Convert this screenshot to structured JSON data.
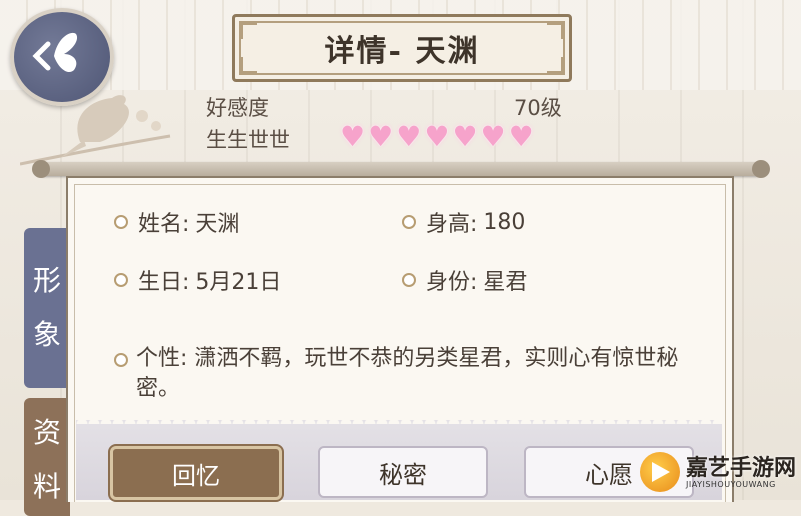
{
  "header": {
    "title": "详情- 天渊"
  },
  "affection": {
    "label": "好感度",
    "level": "70级",
    "tier": "生生世世",
    "hearts": [
      "♥",
      "♥",
      "♥",
      "♥",
      "♥",
      "♥",
      "♥"
    ],
    "heart_color": "#f6a3cb"
  },
  "side_tabs": [
    {
      "label_top": "形",
      "label_bottom": "象"
    },
    {
      "label_top": "资",
      "label_bottom": "料"
    }
  ],
  "profile": {
    "name_label": "姓名:",
    "name_value": "天渊",
    "height_label": "身高:",
    "height_value": "180",
    "birthday_label": "生日:",
    "birthday_value": "5月21日",
    "identity_label": "身份:",
    "identity_value": "星君",
    "personality_label": "个性:",
    "personality_value": "潇洒不羁，玩世不恭的另类星君，实则心有惊世秘密。"
  },
  "buttons": {
    "memory": "回忆",
    "secret": "秘密",
    "wish": "心愿"
  },
  "watermark": {
    "cn": "嘉艺手游网",
    "en": "JIAYISHOUYOUWANG"
  },
  "colors": {
    "tab_active": "#6a7192",
    "tab_inactive": "#8d7159",
    "button_active": "#8b6e50"
  }
}
